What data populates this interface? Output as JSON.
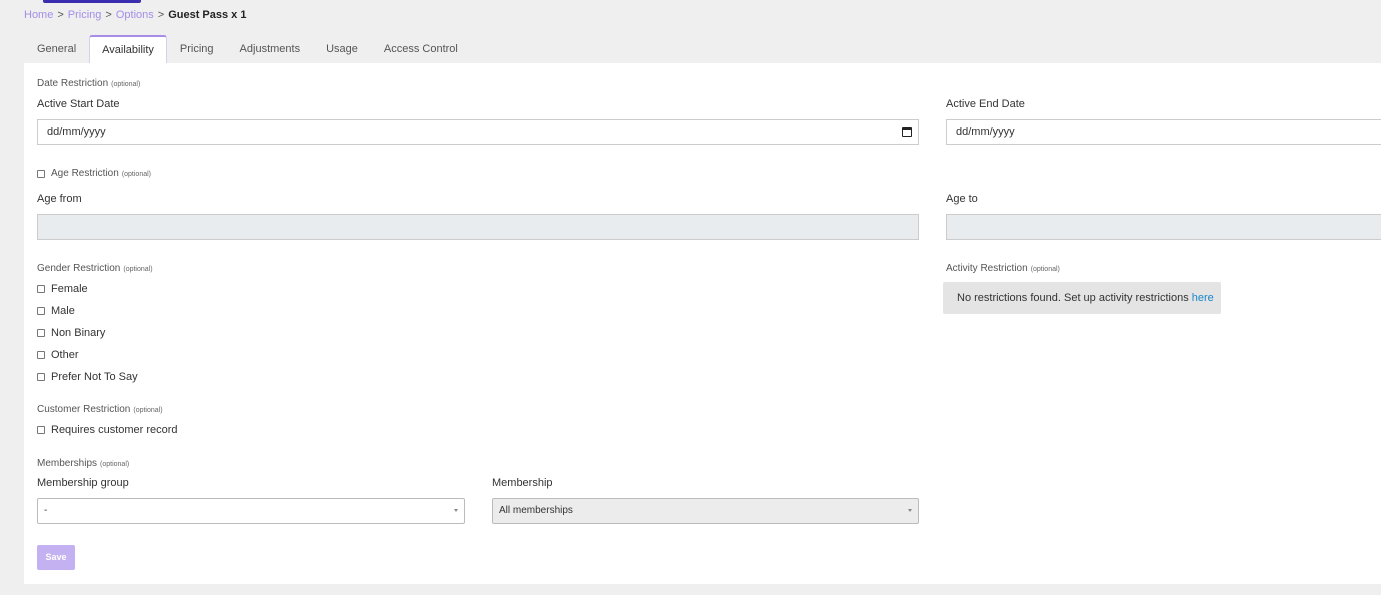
{
  "breadcrumb": {
    "home": "Home",
    "pricing": "Pricing",
    "options": "Options",
    "current": "Guest Pass x 1",
    "separator": ">"
  },
  "tabs": [
    {
      "label": "General"
    },
    {
      "label": "Availability"
    },
    {
      "label": "Pricing"
    },
    {
      "label": "Adjustments"
    },
    {
      "label": "Usage"
    },
    {
      "label": "Access Control"
    }
  ],
  "active_tab": "Availability",
  "date_restriction": {
    "label": "Date Restriction",
    "optional": "(optional)",
    "start_label": "Active Start Date",
    "start_value": "dd/mm/yyyy",
    "end_label": "Active End Date",
    "end_value": "dd/mm/yyyy"
  },
  "age_restriction": {
    "label": "Age Restriction",
    "optional": "(optional)",
    "checked": false,
    "from_label": "Age from",
    "to_label": "Age to"
  },
  "gender_restriction": {
    "label": "Gender Restriction",
    "optional": "(optional)",
    "options": [
      {
        "label": "Female",
        "checked": false
      },
      {
        "label": "Male",
        "checked": false
      },
      {
        "label": "Non Binary",
        "checked": false
      },
      {
        "label": "Other",
        "checked": false
      },
      {
        "label": "Prefer Not To Say",
        "checked": false
      }
    ]
  },
  "activity_restriction": {
    "label": "Activity Restriction",
    "optional": "(optional)",
    "message": "No restrictions found. Set up activity restrictions",
    "link": "here"
  },
  "customer_restriction": {
    "label": "Customer Restriction",
    "optional": "(optional)",
    "option": "Requires customer record",
    "checked": false
  },
  "memberships": {
    "label": "Memberships",
    "optional": "(optional)",
    "group_label": "Membership group",
    "group_value": "-",
    "membership_label": "Membership",
    "membership_value": "All memberships"
  },
  "save_label": "Save",
  "colors": {
    "accent": "#a48ee8",
    "save_button": "#c4b1f2",
    "link": "#1a87c9",
    "top_bar": "#3b2fb0"
  }
}
